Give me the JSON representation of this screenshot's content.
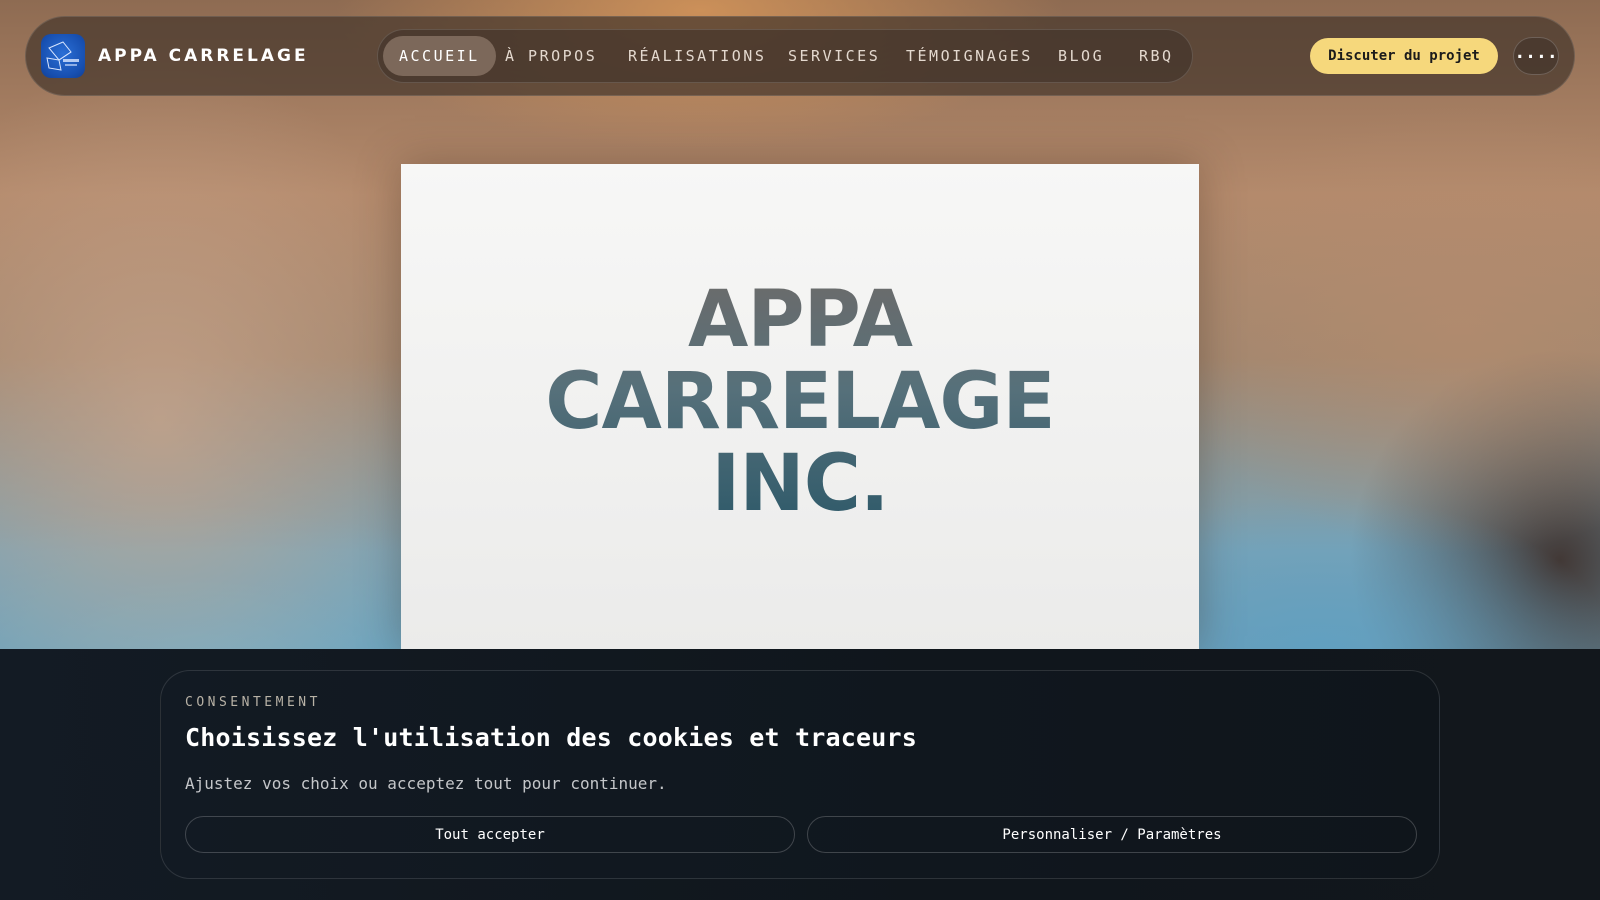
{
  "brand": {
    "name": "APPA CARRELAGE"
  },
  "nav": {
    "items": [
      {
        "label": "ACCUEIL",
        "active": true
      },
      {
        "label": "À PROPOS",
        "active": false
      },
      {
        "label": "RÉALISATIONS",
        "active": false
      },
      {
        "label": "SERVICES",
        "active": false
      },
      {
        "label": "TÉMOIGNAGES",
        "active": false
      },
      {
        "label": "BLOG",
        "active": false
      },
      {
        "label": "RBQ",
        "active": false
      }
    ],
    "cta_label": "Discuter du projet",
    "menu_label": "...."
  },
  "hero": {
    "logo_lines": [
      "APPA",
      "CARRELAGE",
      "INC."
    ]
  },
  "consent": {
    "kicker": "CONSENTEMENT",
    "title": "Choisissez l'utilisation des cookies et traceurs",
    "text": "Ajustez vos choix ou acceptez tout pour continuer.",
    "accept_label": "Tout accepter",
    "settings_label": "Personnaliser / Paramètres"
  },
  "colors": {
    "accent": "#f6d87c",
    "consent_bg": "#10161d",
    "logo_blue": "#1a56bf"
  }
}
